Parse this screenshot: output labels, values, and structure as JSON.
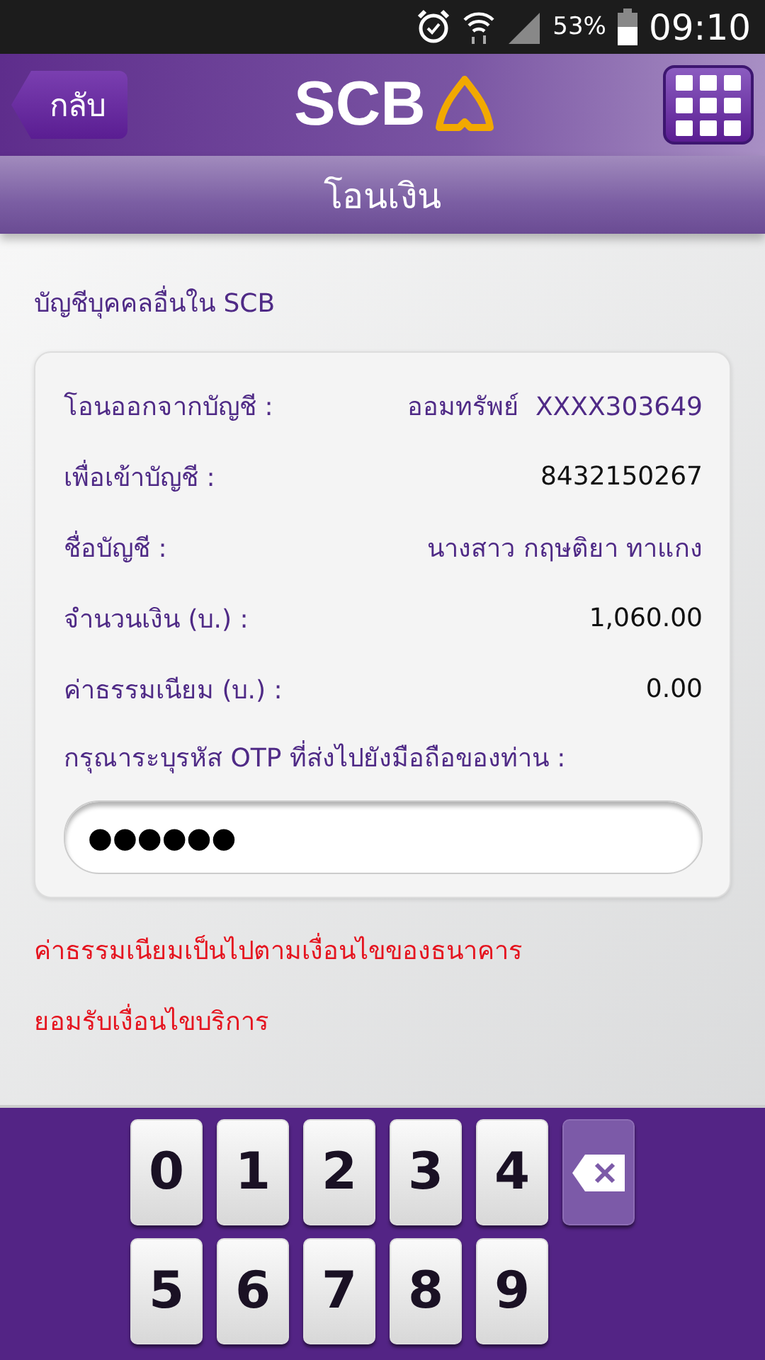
{
  "status_bar": {
    "battery": "53%",
    "time": "09:10"
  },
  "header": {
    "back_label": "กลับ",
    "logo_text": "SCB"
  },
  "title": "โอนเงิน",
  "section_label": "บัญชีบุคคลอื่นใน SCB",
  "details": [
    {
      "label": "โอนออกจากบัญชี :",
      "value": "ออมทรัพย์  XXXX303649",
      "kind": "accent"
    },
    {
      "label": "เพื่อเข้าบัญชี :",
      "value": "8432150267",
      "kind": "plain"
    },
    {
      "label": "ชื่อบัญชี :",
      "value": "นางสาว กฤษติยา ทาแกง",
      "kind": "accent"
    },
    {
      "label": "จำนวนเงิน (บ.) :",
      "value": "1,060.00",
      "kind": "plain"
    },
    {
      "label": "ค่าธรรมเนียม (บ.) :",
      "value": "0.00",
      "kind": "plain"
    }
  ],
  "otp": {
    "label": "กรุณาระบุรหัส OTP ที่ส่งไปยังมือถือของท่าน :",
    "value": "●●●●●●"
  },
  "notes": [
    "ค่าธรรมเนียมเป็นไปตามเงื่อนไขของธนาคาร",
    "ยอมรับเงื่อนไขบริการ"
  ],
  "keypad": [
    [
      {
        "kind": "digit",
        "label": "0"
      },
      {
        "kind": "digit",
        "label": "1"
      },
      {
        "kind": "digit",
        "label": "2"
      },
      {
        "kind": "digit",
        "label": "3"
      },
      {
        "kind": "digit",
        "label": "4"
      },
      {
        "kind": "backspace"
      }
    ],
    [
      {
        "kind": "digit",
        "label": "5"
      },
      {
        "kind": "digit",
        "label": "6"
      },
      {
        "kind": "digit",
        "label": "7"
      },
      {
        "kind": "digit",
        "label": "8"
      },
      {
        "kind": "digit",
        "label": "9"
      }
    ]
  ]
}
